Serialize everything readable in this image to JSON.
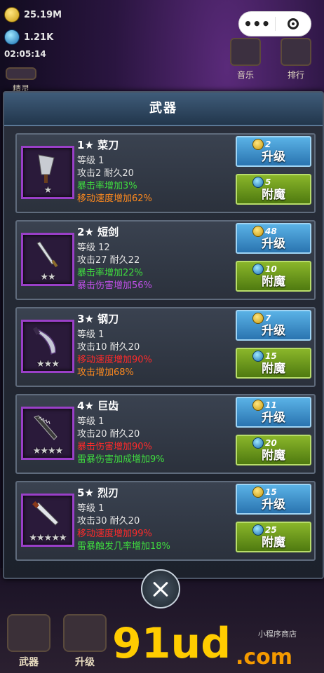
{
  "hud": {
    "gold": "25.19M",
    "gems": "1.21K",
    "time": "02:05:14"
  },
  "top_buttons": [
    "音乐",
    "排行"
  ],
  "top_left_partial": "精灵",
  "panel": {
    "title": "武器"
  },
  "weapons": [
    {
      "index_label": "1",
      "name": "菜刀",
      "stars": "★",
      "level": "等级 1",
      "stats": "攻击2 耐久20",
      "bonus1": "暴击率增加3%",
      "bonus1_color": "#3fdc3f",
      "bonus2": "移动速度增加62%",
      "bonus2_color": "#ff8a1e",
      "upgrade_cost": "2",
      "enchant_cost": "5"
    },
    {
      "index_label": "2",
      "name": "短剑",
      "stars": "★★",
      "level": "等级 12",
      "stats": "攻击27 耐久22",
      "bonus1": "暴击率增加22%",
      "bonus1_color": "#3fdc3f",
      "bonus2": "暴击伤害增加56%",
      "bonus2_color": "#c050e8",
      "upgrade_cost": "48",
      "enchant_cost": "10"
    },
    {
      "index_label": "3",
      "name": "钢刀",
      "stars": "★★★",
      "level": "等级 1",
      "stats": "攻击10 耐久20",
      "bonus1": "移动速度增加90%",
      "bonus1_color": "#ff2a2a",
      "bonus2": "攻击增加68%",
      "bonus2_color": "#ff8a1e",
      "upgrade_cost": "7",
      "enchant_cost": "15"
    },
    {
      "index_label": "4",
      "name": "巨齿",
      "stars": "★★★★",
      "level": "等级 1",
      "stats": "攻击20 耐久20",
      "bonus1": "暴击伤害增加90%",
      "bonus1_color": "#ff2a2a",
      "bonus2": "雷暴伤害加成增加9%",
      "bonus2_color": "#3fdc3f",
      "upgrade_cost": "11",
      "enchant_cost": "20"
    },
    {
      "index_label": "5",
      "name": "烈刃",
      "stars": "★★★★★",
      "level": "等级 1",
      "stats": "攻击30 耐久20",
      "bonus1": "移动速度增加99%",
      "bonus1_color": "#ff2a2a",
      "bonus2": "雷暴触发几率增加18%",
      "bonus2_color": "#3fdc3f",
      "upgrade_cost": "15",
      "enchant_cost": "25"
    }
  ],
  "buttons": {
    "upgrade_label": "升级",
    "enchant_label": "附魔"
  },
  "bottom_tabs": [
    "武器",
    "升级"
  ],
  "watermark": {
    "main": "91ud",
    "suffix": ".com",
    "small": "小程序商店"
  }
}
